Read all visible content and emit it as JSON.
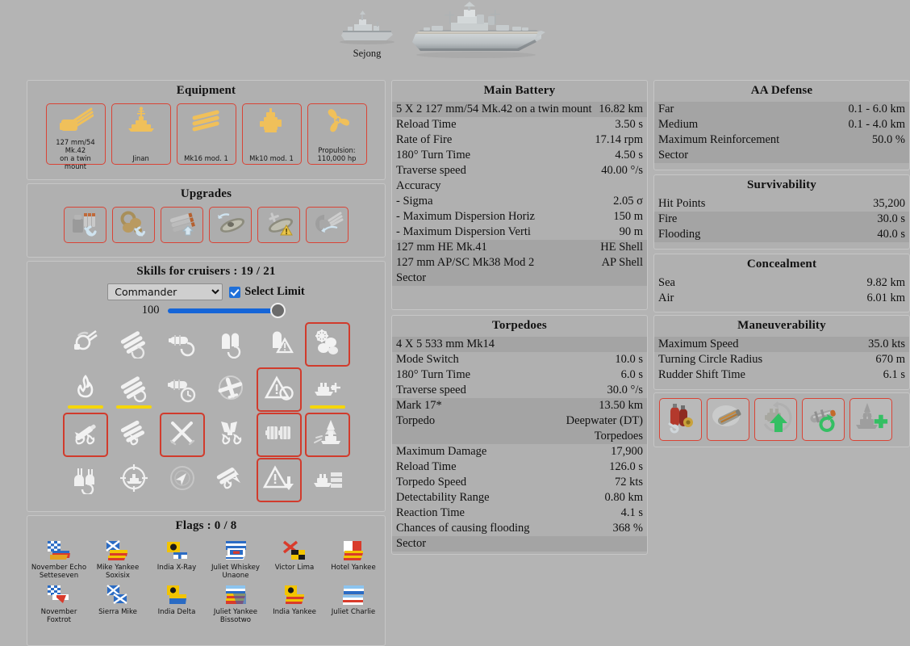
{
  "ship": {
    "name": "Sejong",
    "small_icon": "destroyer-silhouette",
    "large_icon": "cruiser-render"
  },
  "equipment": {
    "title": "Equipment",
    "items": [
      {
        "label": "127 mm/54 Mk.42\non a twin mount",
        "icon": "main-battery-icon"
      },
      {
        "label": "Jinan",
        "icon": "hull-icon"
      },
      {
        "label": "Mk16 mod. 1",
        "icon": "torpedo-tubes-icon"
      },
      {
        "label": "Mk10 mod. 1",
        "icon": "fire-control-icon"
      },
      {
        "label": "Propulsion:\n110,000 hp",
        "icon": "propeller-icon"
      }
    ]
  },
  "upgrades": {
    "title": "Upgrades",
    "items": [
      {
        "icon": "main-armaments-modification-icon"
      },
      {
        "icon": "engine-room-protection-icon"
      },
      {
        "icon": "torpedo-tubes-modification-icon"
      },
      {
        "icon": "propulsion-modification-icon"
      },
      {
        "icon": "aiming-systems-modification-icon"
      },
      {
        "icon": "main-battery-modification-icon"
      }
    ]
  },
  "skills": {
    "title": "Skills for cruisers : 19 / 21",
    "selected_count": 19,
    "max_count": 21,
    "select_label": "Commander",
    "select_options": [
      "Commander"
    ],
    "limit_label": "Select Limit",
    "limit_checked": true,
    "slider_value": "100",
    "slider_percent": 100,
    "grid": [
      [
        {
          "icon": "priority-target-icon",
          "selected": false,
          "underline": false
        },
        {
          "icon": "gun-feeder-icon",
          "selected": false,
          "underline": false
        },
        {
          "icon": "torpedo-reload-booster-icon",
          "selected": false,
          "underline": false
        },
        {
          "icon": "ammo-swap-icon",
          "selected": false,
          "underline": false
        },
        {
          "icon": "shell-alert-icon",
          "selected": false,
          "underline": false
        },
        {
          "icon": "consumables-enhancements-icon",
          "selected": true,
          "underline": false
        }
      ],
      [
        {
          "icon": "fire-prevention-icon",
          "selected": false,
          "underline": true
        },
        {
          "icon": "torpedo-acceleration-icon",
          "selected": false,
          "underline": true
        },
        {
          "icon": "torpedo-tubes-timer-icon",
          "selected": false,
          "underline": false
        },
        {
          "icon": "aircraft-detection-icon",
          "selected": false,
          "underline": false
        },
        {
          "icon": "radio-location-icon",
          "selected": true,
          "underline": false
        },
        {
          "icon": "ship-gun-boost-icon",
          "selected": false,
          "underline": true
        }
      ],
      [
        {
          "icon": "incoming-fire-alert-icon",
          "selected": true,
          "underline": false
        },
        {
          "icon": "torpedo-fire-icon",
          "selected": false,
          "underline": false
        },
        {
          "icon": "crossed-swords-icon",
          "selected": true,
          "underline": false
        },
        {
          "icon": "rudder-fire-icon",
          "selected": false,
          "underline": false
        },
        {
          "icon": "torpedo-armament-expertise-icon",
          "selected": true,
          "underline": false
        },
        {
          "icon": "concealment-expert-icon",
          "selected": true,
          "underline": false
        }
      ],
      [
        {
          "icon": "adrenaline-rush-icon",
          "selected": false,
          "underline": false
        },
        {
          "icon": "target-lock-icon",
          "selected": false,
          "underline": false
        },
        {
          "icon": "vigilance-icon",
          "selected": false,
          "underline": false
        },
        {
          "icon": "torpedo-damage-icon",
          "selected": false,
          "underline": false
        },
        {
          "icon": "alert-down-icon",
          "selected": true,
          "underline": false
        },
        {
          "icon": "ship-armor-icon",
          "selected": false,
          "underline": false
        }
      ]
    ]
  },
  "flags": {
    "title": "Flags : 0 / 8",
    "equipped": 0,
    "max": 8,
    "items": [
      {
        "name": "November Echo\nSetteseven",
        "icon": "flag-november-echo-setteseven"
      },
      {
        "name": "Mike Yankee\nSoxisix",
        "icon": "flag-mike-yankee-soxisix"
      },
      {
        "name": "India X-Ray",
        "icon": "flag-india-x-ray"
      },
      {
        "name": "Juliet Whiskey\nUnaone",
        "icon": "flag-juliet-whiskey-unaone"
      },
      {
        "name": "Victor Lima",
        "icon": "flag-victor-lima"
      },
      {
        "name": "Hotel Yankee",
        "icon": "flag-hotel-yankee"
      },
      {
        "name": "November\nFoxtrot",
        "icon": "flag-november-foxtrot"
      },
      {
        "name": "Sierra Mike",
        "icon": "flag-sierra-mike"
      },
      {
        "name": "India Delta",
        "icon": "flag-india-delta"
      },
      {
        "name": "Juliet Yankee\nBissotwo",
        "icon": "flag-juliet-yankee-bissotwo"
      },
      {
        "name": "India Yankee",
        "icon": "flag-india-yankee"
      },
      {
        "name": "Juliet Charlie",
        "icon": "flag-juliet-charlie"
      }
    ]
  },
  "main_battery": {
    "title": "Main Battery",
    "rows": [
      {
        "k": "5 X 2 127 mm/54 Mk.42 on a twin mount",
        "v": "16.82 km",
        "dark": true,
        "wrap": true
      },
      {
        "k": "Reload Time",
        "v": "3.50 s",
        "dark": false
      },
      {
        "k": "Rate of Fire",
        "v": "17.14 rpm",
        "dark": false
      },
      {
        "k": "180° Turn Time",
        "v": "4.50 s",
        "dark": false
      },
      {
        "k": "Traverse speed",
        "v": "40.00 °/s",
        "dark": false
      },
      {
        "k": "Accuracy",
        "v": "",
        "dark": false
      },
      {
        "k": "- Sigma",
        "v": "2.05 σ",
        "dark": false
      },
      {
        "k": "- Maximum Dispersion Horiz",
        "v": "150 m",
        "dark": false
      },
      {
        "k": "- Maximum Dispersion Verti",
        "v": "90 m",
        "dark": false
      },
      {
        "k": "127 mm HE Mk.41",
        "v": "HE Shell",
        "dark": true
      },
      {
        "k": "127 mm AP/SC Mk38 Mod 2",
        "v": "AP Shell",
        "dark": true
      },
      {
        "k": "Sector",
        "v": "",
        "dark": true
      }
    ]
  },
  "torpedoes": {
    "title": "Torpedoes",
    "rows": [
      {
        "k": "4 X 5 533 mm Mk14",
        "v": "",
        "dark": true
      },
      {
        "k": "Mode Switch",
        "v": "10.0 s",
        "dark": false
      },
      {
        "k": "180° Turn Time",
        "v": "6.0 s",
        "dark": false
      },
      {
        "k": "Traverse speed",
        "v": "30.0 °/s",
        "dark": false
      },
      {
        "k": "Mark 17*",
        "v": "13.50 km",
        "dark": true
      },
      {
        "k": "Torpedo",
        "v": "Deepwater (DT)\nTorpedoes",
        "dark": true,
        "wrap": true
      },
      {
        "k": "Maximum Damage",
        "v": "17,900",
        "dark": false
      },
      {
        "k": "Reload Time",
        "v": "126.0 s",
        "dark": false
      },
      {
        "k": "Torpedo Speed",
        "v": "72 kts",
        "dark": false
      },
      {
        "k": "Detectability Range",
        "v": "0.80 km",
        "dark": false
      },
      {
        "k": "Reaction Time",
        "v": "4.1 s",
        "dark": false
      },
      {
        "k": "Chances of causing flooding",
        "v": "368 %",
        "dark": false
      },
      {
        "k": "Sector",
        "v": "",
        "dark": true
      }
    ]
  },
  "aa_defense": {
    "title": "AA Defense",
    "rows": [
      {
        "k": "Far",
        "v": "0.1 - 6.0 km",
        "dark": true
      },
      {
        "k": "Medium",
        "v": "0.1 - 4.0 km",
        "dark": true
      },
      {
        "k": "Maximum Reinforcement",
        "v": "50.0 %",
        "dark": true
      },
      {
        "k": "Sector",
        "v": "",
        "dark": true
      }
    ]
  },
  "survivability": {
    "title": "Survivability",
    "rows": [
      {
        "k": "Hit Points",
        "v": "35,200",
        "dark": false
      },
      {
        "k": "Fire",
        "v": "30.0 s",
        "dark": true
      },
      {
        "k": "Flooding",
        "v": "40.0 s",
        "dark": true
      }
    ]
  },
  "concealment": {
    "title": "Concealment",
    "rows": [
      {
        "k": "Sea",
        "v": "9.82 km",
        "dark": false
      },
      {
        "k": "Air",
        "v": "6.01 km",
        "dark": false
      }
    ]
  },
  "maneuverability": {
    "title": "Maneuverability",
    "rows": [
      {
        "k": "Maximum Speed",
        "v": "35.0 kts",
        "dark": true
      },
      {
        "k": "Turning Circle Radius",
        "v": "670 m",
        "dark": false
      },
      {
        "k": "Rudder Shift Time",
        "v": "6.1 s",
        "dark": false
      }
    ]
  },
  "consumables": {
    "items": [
      {
        "icon": "damage-control-party-icon"
      },
      {
        "icon": "smoke-generator-icon"
      },
      {
        "icon": "engine-boost-icon"
      },
      {
        "icon": "torpedo-reload-booster-icon"
      },
      {
        "icon": "repair-party-icon"
      }
    ]
  },
  "colors": {
    "background": "#b4b4b4",
    "panel": "#b0b0b0",
    "row_dark": "#a4a4a4",
    "accent_red": "#d94436",
    "accent_blue": "#1565d8",
    "accent_yellow": "#f5d60a",
    "equipment_icon": "#f0c05a",
    "consumable_green": "#2fbf5f"
  }
}
